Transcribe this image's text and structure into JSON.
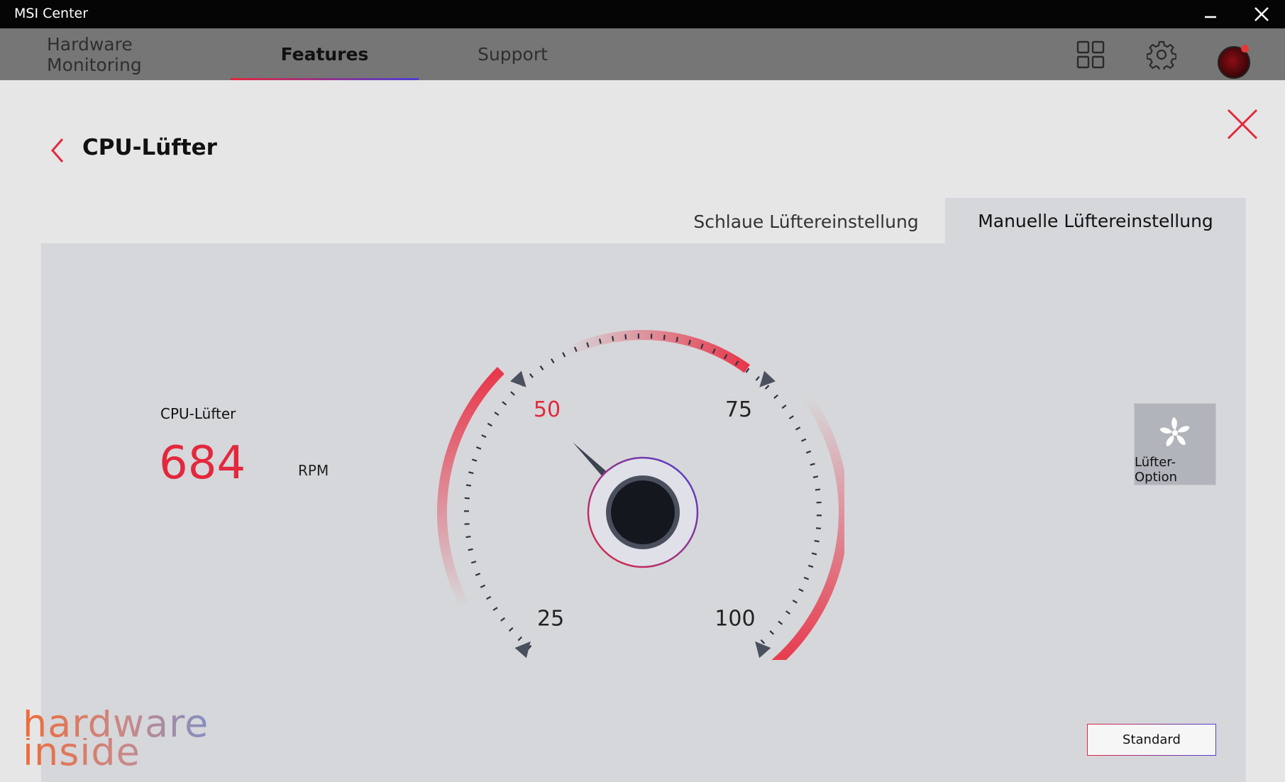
{
  "titlebar": {
    "title": "MSI Center"
  },
  "nav": {
    "tabs": [
      {
        "label": "Hardware Monitoring"
      },
      {
        "label": "Features"
      },
      {
        "label": "Support"
      }
    ]
  },
  "page": {
    "title": "CPU-Lüfter"
  },
  "mode_tabs": {
    "smart": "Schlaue Lüftereinstellung",
    "manual": "Manuelle Lüftereinstellung"
  },
  "fan": {
    "label": "CPU-Lüfter",
    "rpm": "684",
    "unit": "RPM"
  },
  "gauge": {
    "labels": [
      "25",
      "50",
      "75",
      "100"
    ],
    "active_label": "50",
    "needle_value": 55
  },
  "fan_option": {
    "label": "Lüfter-Option"
  },
  "standard_button": {
    "label": "Standard"
  },
  "watermark": {
    "line1": "hardware",
    "line2": "inside"
  },
  "colors": {
    "accent": "#e3283d",
    "accent_blue": "#4b3fd6"
  }
}
